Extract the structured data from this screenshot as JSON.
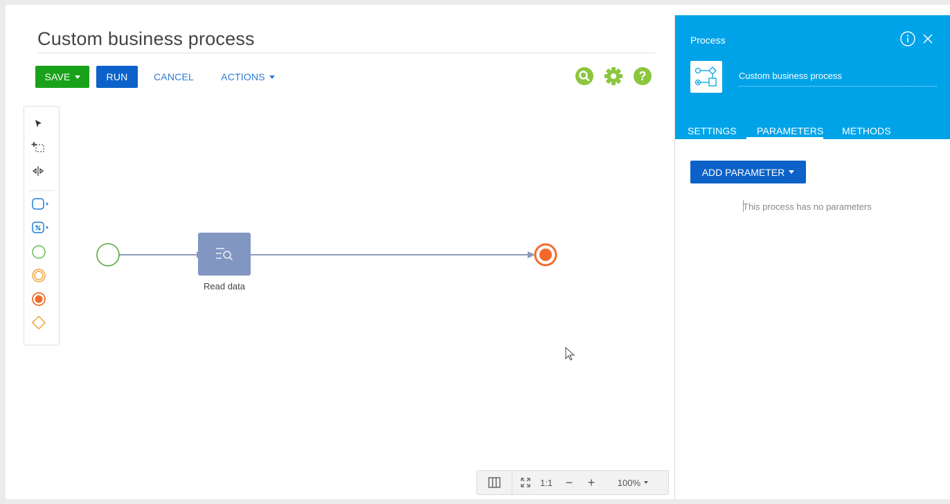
{
  "designer": {
    "title": "Custom business process",
    "save_label": "SAVE",
    "run_label": "RUN",
    "cancel_label": "CANCEL",
    "actions_label": "ACTIONS"
  },
  "diagram": {
    "task_label": "Read data"
  },
  "zoom": {
    "one_to_one": "1:1",
    "minus": "−",
    "plus": "+",
    "level": "100%"
  },
  "panel": {
    "header_label": "Process",
    "process_name": "Custom business process",
    "tabs": [
      {
        "label": "SETTINGS",
        "active": false
      },
      {
        "label": "PARAMETERS",
        "active": true
      },
      {
        "label": "METHODS",
        "active": false
      }
    ],
    "add_parameter_label": "ADD PARAMETER",
    "empty_message": "This process has no parameters"
  },
  "colors": {
    "save": "#1aa11a",
    "primary": "#0c62c9",
    "panel_header": "#00a3e8",
    "start_event": "#5aaa3c",
    "end_event": "#f26a2b",
    "task": "#8197c2",
    "top_icons": "#8cc63f"
  }
}
